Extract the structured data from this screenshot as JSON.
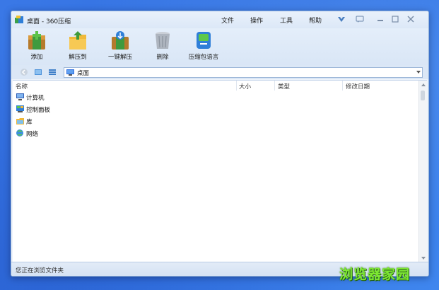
{
  "window": {
    "title": "桌面 - 360压缩"
  },
  "menu": {
    "file": "文件",
    "operate": "操作",
    "tools": "工具",
    "help": "帮助"
  },
  "toolbar": {
    "add": "添加",
    "extract_to": "解压到",
    "one_click_extract": "一键解压",
    "delete": "删除",
    "language": "压缩包语言"
  },
  "address": {
    "path": "桌面"
  },
  "columns": {
    "name": "名称",
    "size": "大小",
    "type": "类型",
    "modified": "修改日期"
  },
  "items": [
    {
      "label": "计算机",
      "icon": "computer-icon"
    },
    {
      "label": "控制面板",
      "icon": "control-panel-icon"
    },
    {
      "label": "库",
      "icon": "library-icon"
    },
    {
      "label": "网络",
      "icon": "network-icon"
    }
  ],
  "status": {
    "text": "您正在浏览文件夹"
  },
  "watermark": {
    "text": "浏览器家园"
  },
  "colors": {
    "accent": "#2f6ee0",
    "window_bg": "#eef3fa",
    "watermark": "#7ee832"
  }
}
